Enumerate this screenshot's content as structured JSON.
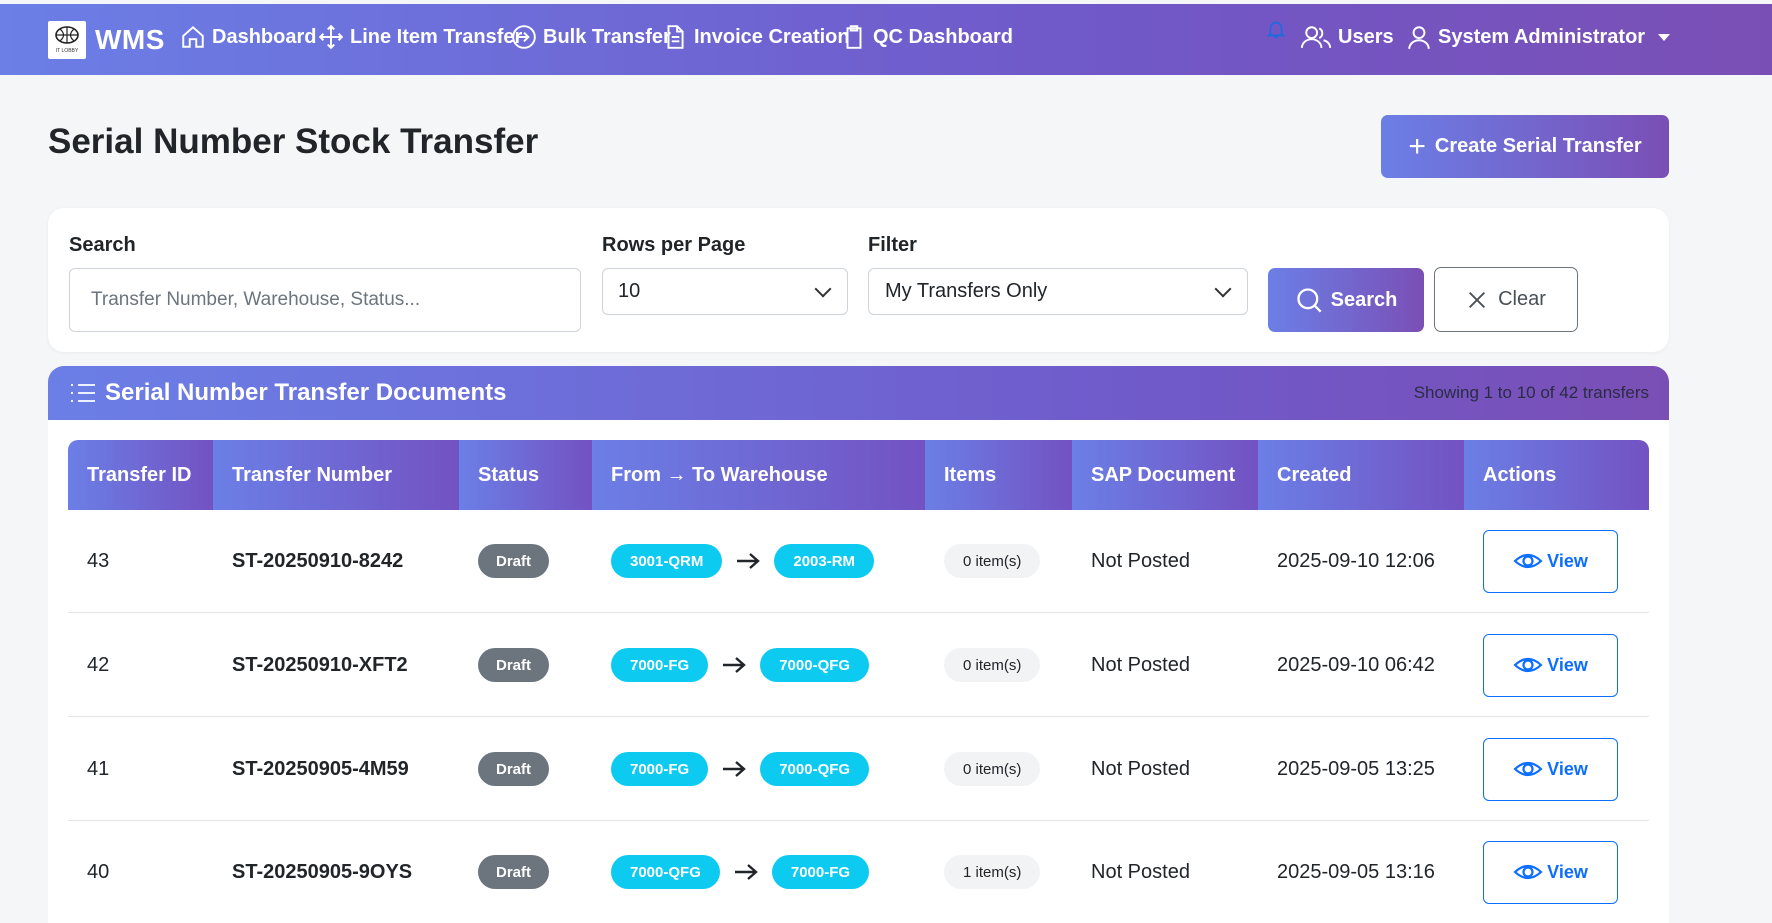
{
  "navbar": {
    "brand": "WMS",
    "logo_text": "IT LOBBY",
    "items": [
      {
        "label": "Dashboard",
        "icon": "home-icon"
      },
      {
        "label": "Line Item Transfer",
        "icon": "move-arrows-icon"
      },
      {
        "label": "Bulk Transfer",
        "icon": "arrow-circle-icon"
      },
      {
        "label": "Invoice Creation",
        "icon": "document-icon"
      },
      {
        "label": "QC Dashboard",
        "icon": "clipboard-icon"
      }
    ],
    "users_label": "Users",
    "admin_label": "System Administrator"
  },
  "page": {
    "title": "Serial Number Stock Transfer",
    "create_button": "Create Serial Transfer"
  },
  "filters": {
    "search_label": "Search",
    "search_placeholder": "Transfer Number, Warehouse, Status...",
    "rows_label": "Rows per Page",
    "rows_value": "10",
    "filter_label": "Filter",
    "filter_value": "My Transfers Only",
    "search_button": "Search",
    "clear_button": "Clear"
  },
  "table": {
    "title": "Serial Number Transfer Documents",
    "showing": "Showing 1 to 10 of 42 transfers",
    "columns": [
      "Transfer ID",
      "Transfer Number",
      "Status",
      "From → To Warehouse",
      "Items",
      "SAP Document",
      "Created",
      "Actions"
    ],
    "rows": [
      {
        "id": "43",
        "number": "ST-20250910-8242",
        "status": "Draft",
        "from": "3001-QRM",
        "to": "2003-RM",
        "items": "0 item(s)",
        "sap": "Not Posted",
        "created": "2025-09-10 12:06",
        "action": "View"
      },
      {
        "id": "42",
        "number": "ST-20250910-XFT2",
        "status": "Draft",
        "from": "7000-FG",
        "to": "7000-QFG",
        "items": "0 item(s)",
        "sap": "Not Posted",
        "created": "2025-09-10 06:42",
        "action": "View"
      },
      {
        "id": "41",
        "number": "ST-20250905-4M59",
        "status": "Draft",
        "from": "7000-FG",
        "to": "7000-QFG",
        "items": "0 item(s)",
        "sap": "Not Posted",
        "created": "2025-09-05 13:25",
        "action": "View"
      },
      {
        "id": "40",
        "number": "ST-20250905-9OYS",
        "status": "Draft",
        "from": "7000-QFG",
        "to": "7000-FG",
        "items": "1 item(s)",
        "sap": "Not Posted",
        "created": "2025-09-05 13:16",
        "action": "View"
      }
    ]
  },
  "colors": {
    "accent_start": "#6b7fe6",
    "accent_end": "#7a4fb5",
    "draft_badge": "#6c757d",
    "warehouse_pill": "#0dcaf0",
    "view_button": "#0d6efd"
  }
}
